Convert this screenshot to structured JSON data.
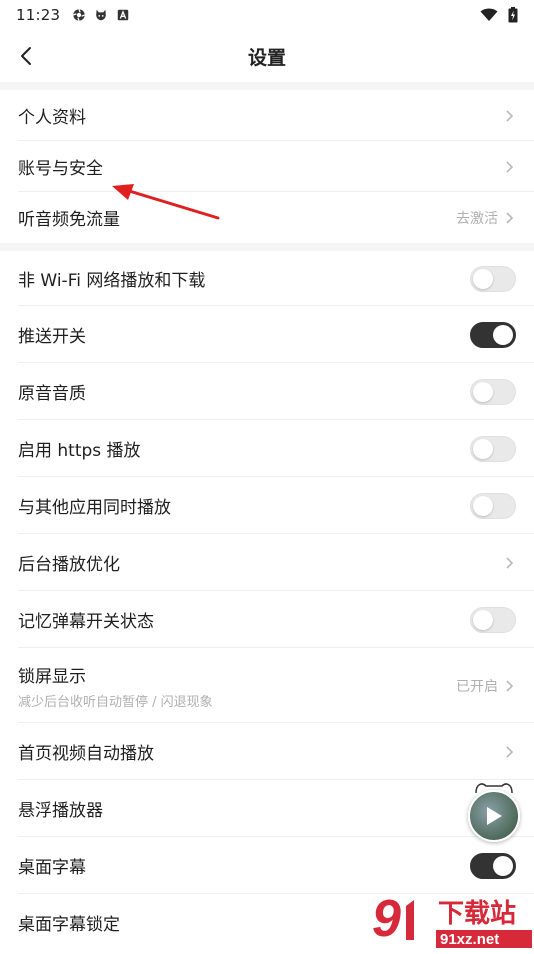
{
  "status_bar": {
    "time": "11:23",
    "left_icons": [
      "settings-gear-icon",
      "github-cat-icon",
      "a-badge-icon"
    ],
    "right_icons": [
      "wifi-icon",
      "battery-charging-icon"
    ]
  },
  "header": {
    "title": "设置",
    "back_icon": "back-chevron-icon"
  },
  "section1": [
    {
      "label": "个人资料",
      "control": "chevron"
    },
    {
      "label": "账号与安全",
      "control": "chevron"
    },
    {
      "label": "听音频免流量",
      "status": "去激活",
      "control": "chevron"
    }
  ],
  "section2": [
    {
      "label": "非 Wi-Fi 网络播放和下载",
      "control": "toggle",
      "on": false
    },
    {
      "label": "推送开关",
      "control": "toggle",
      "on": true
    },
    {
      "label": "原音音质",
      "control": "toggle",
      "on": false
    },
    {
      "label": "启用 https 播放",
      "control": "toggle",
      "on": false
    },
    {
      "label": "与其他应用同时播放",
      "control": "toggle",
      "on": false
    },
    {
      "label": "后台播放优化",
      "control": "chevron"
    },
    {
      "label": "记忆弹幕开关状态",
      "control": "toggle",
      "on": false
    },
    {
      "label": "锁屏显示",
      "sublabel": "减少后台收听自动暂停 / 闪退现象",
      "status": "已开启",
      "control": "chevron"
    },
    {
      "label": "首页视频自动播放",
      "control": "chevron"
    },
    {
      "label": "悬浮播放器",
      "control": "none"
    },
    {
      "label": "桌面字幕",
      "control": "toggle",
      "on": true
    },
    {
      "label": "桌面字幕锁定",
      "control": "none"
    }
  ],
  "overlay": {
    "annotation": "red-arrow-pointing-to-account-security",
    "floating_player_icon": "play-icon",
    "watermark_text_cn": "下载站",
    "watermark_url": "91xz.net"
  },
  "colors": {
    "toggle_on": "#333333",
    "toggle_off": "#e9e9e9",
    "secondary_text": "#b0b0b0",
    "section_gap": "#f5f5f5",
    "annotation_red": "#e02020",
    "watermark_red": "#d6293a"
  }
}
